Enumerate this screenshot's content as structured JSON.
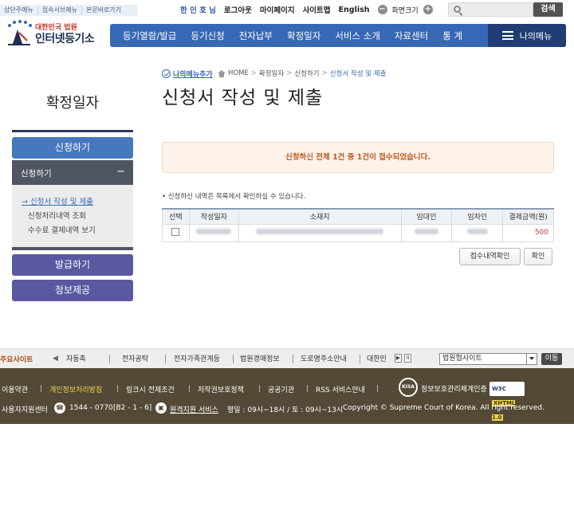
{
  "skip_nav": [
    "상단주메뉴",
    "접속서브메뉴",
    "본문바로가기"
  ],
  "util": {
    "links": [
      "한 인 호 님",
      "로그아웃",
      "마이페이지",
      "사이트맵",
      "English"
    ],
    "zoom_label": "화면크기",
    "zoom_minus": "−",
    "zoom_plus": "+",
    "search_placeholder": "",
    "search_button": "검색"
  },
  "logo": {
    "sub": "대한민국 법원",
    "name": "인터넷등기소"
  },
  "gnb": {
    "items": [
      "등기열람/발급",
      "등기신청",
      "전자납부",
      "확정일자",
      "서비스 소개",
      "자료센터",
      "통 계"
    ],
    "my_menu": "나의메뉴"
  },
  "sidebar": {
    "title": "확정일자",
    "menu_apply": "신청하기",
    "sub_header": "신청하기",
    "sub_toggle": "−",
    "sub_items": [
      "→ 신청서 작성 및 제출",
      "신청처리내역 조회",
      "수수료 결제내역 보기"
    ],
    "menu_issue": "발급하기",
    "menu_info": "정보제공"
  },
  "breadcrumb": {
    "add_menu": "나의메뉴추가",
    "items": [
      "HOME",
      "확정일자",
      "신청하기",
      "신청서 작성 및 제출"
    ],
    "separator": ">"
  },
  "page_title": "신청서 작성 및 제출",
  "notice": "신청하신 전체 1건 중 1건이 접수되었습니다.",
  "info": "• 신청하신 내역은 목록에서 확인하실 수 있습니다.",
  "table": {
    "headers": [
      "선택",
      "작성일자",
      "소재지",
      "임대인",
      "임차인",
      "결제금액(원)"
    ],
    "rows": [
      {
        "amount": "500"
      }
    ]
  },
  "buttons": {
    "receipt": "접수내역확인",
    "confirm": "확인"
  },
  "sites": {
    "label": "주요사이트",
    "prev": "◀",
    "next": "▶",
    "items": [
      "자동촉",
      "전자공탁",
      "전자가족관계등",
      "법원경매정보",
      "도로명주소안내",
      "대한민"
    ],
    "pause": "II",
    "select_value": "법원협사이트",
    "go": "이동"
  },
  "footer": {
    "links": [
      "이용약관",
      "개인정보처리방침",
      "링크시 전제조건",
      "저작권보호정책",
      "공공기관",
      "RSS 서비스안내"
    ],
    "separator": "|",
    "kisa_badge": "KISA",
    "kisa": "정보보호관리체계인증",
    "w3c": "W3C",
    "w3c_sub": "XHTML 1.0",
    "center_label": "사용자지원센터",
    "phone": "1544 - 0770",
    "phone_option": "[B2 - 1 - 6]",
    "remote": "원격지원 서비스",
    "hours": "평일 : 09시~18시 / 토 : 09시~13시",
    "copyright": "Copyright © Supreme Court of Korea.  All right reserved."
  }
}
